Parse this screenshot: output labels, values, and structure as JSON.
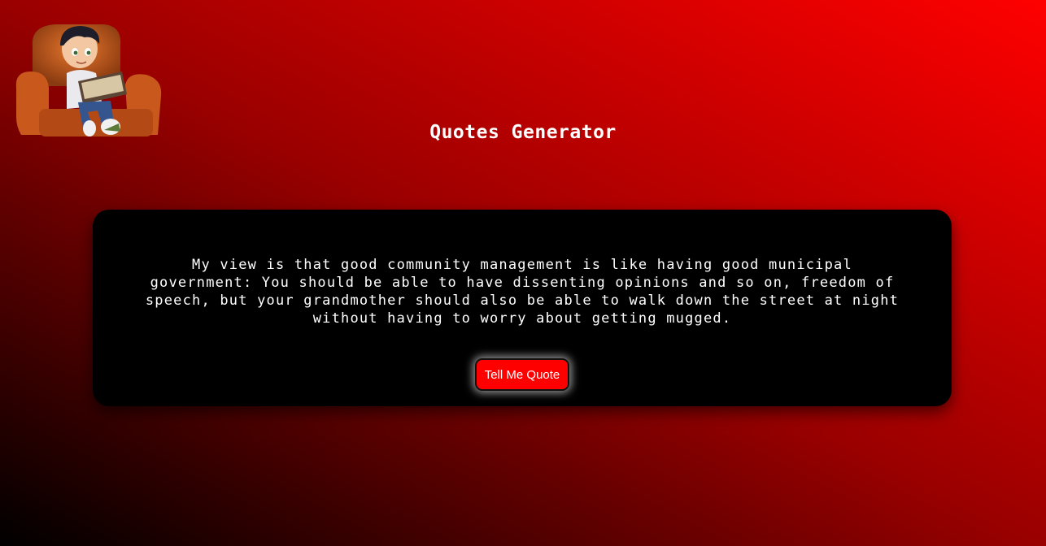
{
  "logo": {
    "icon": "boy-reading-in-armchair-illustration"
  },
  "header": {
    "title": "Quotes Generator"
  },
  "quote": {
    "text": "My view is that good community management is like having good municipal government: You should be able to have dissenting opinions and so on, freedom of speech, but your grandmother should also be able to walk down the street at night without having to worry about getting mugged."
  },
  "actions": {
    "button_label": "Tell Me Quote"
  },
  "colors": {
    "accent": "#ff0000",
    "card_background": "#000000",
    "text": "#ffffff"
  }
}
